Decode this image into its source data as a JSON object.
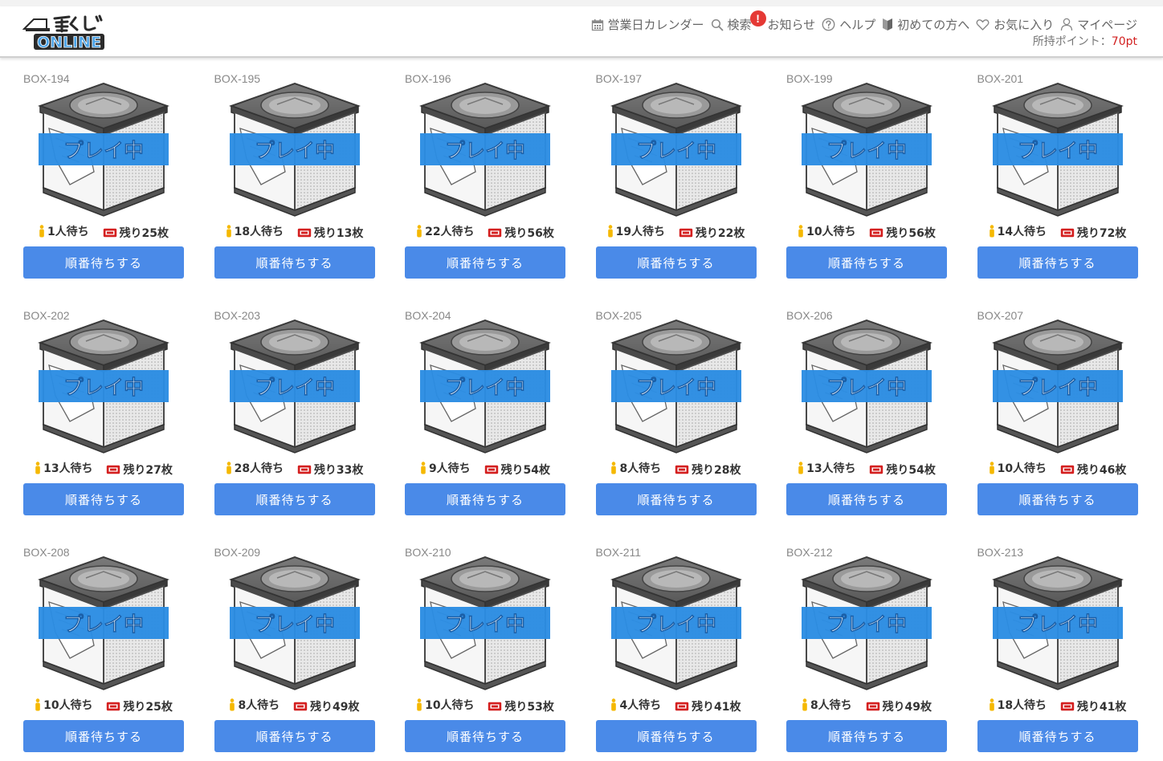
{
  "header": {
    "logo_alt": "一番くじONLINE",
    "nav": [
      {
        "label": "営業日カレンダー",
        "icon": "calendar-icon"
      },
      {
        "label": "検索",
        "icon": "search-icon"
      },
      {
        "label": "お知らせ",
        "icon": "alert-icon",
        "badge": "!"
      },
      {
        "label": "ヘルプ",
        "icon": "help-icon"
      },
      {
        "label": "初めての方へ",
        "icon": "beginner-icon"
      },
      {
        "label": "お気に入り",
        "icon": "heart-icon"
      },
      {
        "label": "マイページ",
        "icon": "user-icon"
      }
    ],
    "points_label": "所持ポイント：",
    "points_value": "70pt"
  },
  "colors": {
    "button": "#4a8ae8",
    "banner": "#2b8de3",
    "badge": "#e53935",
    "points": "#d22020",
    "ticket": "#d42020",
    "person": "#f5b800"
  },
  "boxes": [
    {
      "id": "BOX-194",
      "waiting": "1人待ち",
      "remaining": "残り25枚",
      "status": "プレイ中",
      "button": "順番待ちする"
    },
    {
      "id": "BOX-195",
      "waiting": "18人待ち",
      "remaining": "残り13枚",
      "status": "プレイ中",
      "button": "順番待ちする"
    },
    {
      "id": "BOX-196",
      "waiting": "22人待ち",
      "remaining": "残り56枚",
      "status": "プレイ中",
      "button": "順番待ちする"
    },
    {
      "id": "BOX-197",
      "waiting": "19人待ち",
      "remaining": "残り22枚",
      "status": "プレイ中",
      "button": "順番待ちする"
    },
    {
      "id": "BOX-199",
      "waiting": "10人待ち",
      "remaining": "残り56枚",
      "status": "プレイ中",
      "button": "順番待ちする"
    },
    {
      "id": "BOX-201",
      "waiting": "14人待ち",
      "remaining": "残り72枚",
      "status": "プレイ中",
      "button": "順番待ちする"
    },
    {
      "id": "BOX-202",
      "waiting": "13人待ち",
      "remaining": "残り27枚",
      "status": "プレイ中",
      "button": "順番待ちする"
    },
    {
      "id": "BOX-203",
      "waiting": "28人待ち",
      "remaining": "残り33枚",
      "status": "プレイ中",
      "button": "順番待ちする"
    },
    {
      "id": "BOX-204",
      "waiting": "9人待ち",
      "remaining": "残り54枚",
      "status": "プレイ中",
      "button": "順番待ちする"
    },
    {
      "id": "BOX-205",
      "waiting": "8人待ち",
      "remaining": "残り28枚",
      "status": "プレイ中",
      "button": "順番待ちする"
    },
    {
      "id": "BOX-206",
      "waiting": "13人待ち",
      "remaining": "残り54枚",
      "status": "プレイ中",
      "button": "順番待ちする"
    },
    {
      "id": "BOX-207",
      "waiting": "10人待ち",
      "remaining": "残り46枚",
      "status": "プレイ中",
      "button": "順番待ちする"
    },
    {
      "id": "BOX-208",
      "waiting": "10人待ち",
      "remaining": "残り25枚",
      "status": "プレイ中",
      "button": "順番待ちする"
    },
    {
      "id": "BOX-209",
      "waiting": "8人待ち",
      "remaining": "残り49枚",
      "status": "プレイ中",
      "button": "順番待ちする"
    },
    {
      "id": "BOX-210",
      "waiting": "10人待ち",
      "remaining": "残り53枚",
      "status": "プレイ中",
      "button": "順番待ちする"
    },
    {
      "id": "BOX-211",
      "waiting": "4人待ち",
      "remaining": "残り41枚",
      "status": "プレイ中",
      "button": "順番待ちする"
    },
    {
      "id": "BOX-212",
      "waiting": "8人待ち",
      "remaining": "残り49枚",
      "status": "プレイ中",
      "button": "順番待ちする"
    },
    {
      "id": "BOX-213",
      "waiting": "18人待ち",
      "remaining": "残り41枚",
      "status": "プレイ中",
      "button": "順番待ちする"
    }
  ]
}
